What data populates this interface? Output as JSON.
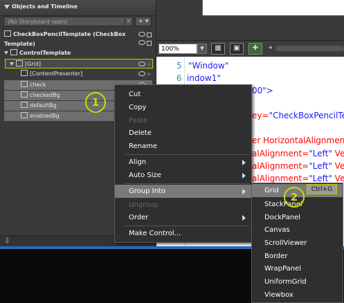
{
  "panel": {
    "title": "Objects and Timeline",
    "storyboard_placeholder": "(No Storyboard open)",
    "storyboard_close": "×",
    "storyboard_add": "+ ▾",
    "template_title": "CheckBoxPencilTemplate (CheckBox Template)",
    "tree": [
      {
        "label": "ControlTemplate"
      },
      {
        "label": "[Grid]"
      },
      {
        "label": "[ContentPresenter]"
      },
      {
        "label": "check"
      },
      {
        "label": "checkedBg"
      },
      {
        "label": "defaultBg"
      },
      {
        "label": "enabledBg"
      }
    ]
  },
  "toolbar": {
    "zoom": "100%"
  },
  "code": {
    "line_numbers": [
      "5",
      "6"
    ],
    "lines": [
      {
        "text": "\"Window\"",
        "color": "blue"
      },
      {
        "text": "indow1\"",
        "color": "blue"
      },
      {
        "text": "00\">",
        "color": "blue"
      },
      {
        "text": "ey=\"CheckBoxPencilTem",
        "color": "mixed"
      },
      {
        "text": "er HorizontalAlignmen",
        "color": "red"
      },
      {
        "text": "alAlignment=\"Left\" Ver",
        "color": "mixed"
      },
      {
        "text": "alAlignment=\"Left\" Ver",
        "color": "mixed"
      },
      {
        "text": "alAlignment=\"Left\" Ver",
        "color": "mixed"
      }
    ]
  },
  "context_menu": {
    "items": [
      {
        "label": "Cut",
        "enabled": true,
        "submenu": false
      },
      {
        "label": "Copy",
        "enabled": true,
        "submenu": false
      },
      {
        "label": "Paste",
        "enabled": false,
        "submenu": false
      },
      {
        "label": "Delete",
        "enabled": true,
        "submenu": false
      },
      {
        "label": "Rename",
        "enabled": true,
        "submenu": false
      },
      {
        "label": "Align",
        "enabled": true,
        "submenu": true
      },
      {
        "label": "Auto Size",
        "enabled": true,
        "submenu": true
      },
      {
        "label": "Group Into",
        "enabled": true,
        "submenu": true,
        "highlighted": true
      },
      {
        "label": "Ungroup",
        "enabled": false,
        "submenu": false
      },
      {
        "label": "Order",
        "enabled": true,
        "submenu": true
      },
      {
        "label": "Make Control...",
        "enabled": true,
        "submenu": false
      }
    ]
  },
  "submenu": {
    "items": [
      "Grid",
      "StackPanel",
      "DockPanel",
      "Canvas",
      "ScrollViewer",
      "Border",
      "WrapPanel",
      "UniformGrid",
      "Viewbox"
    ],
    "shortcut": "Ctrl+G"
  },
  "annotations": {
    "callout_1": "1",
    "callout_2": "2",
    "color": "#c8e000"
  }
}
